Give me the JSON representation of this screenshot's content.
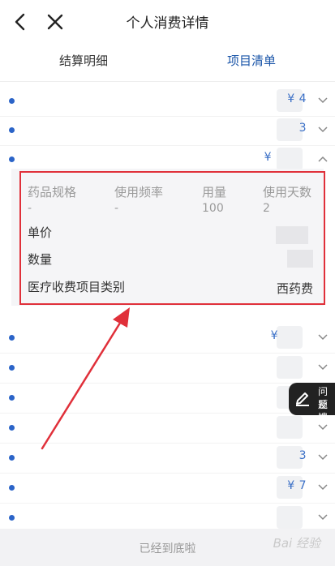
{
  "header": {
    "title": "个人消费详情"
  },
  "tabs": [
    {
      "label": "结算明细",
      "active": false
    },
    {
      "label": "项目清单",
      "active": true
    }
  ],
  "rows": [
    {
      "amount": "¥   4"
    },
    {
      "amount": "3"
    },
    {
      "amount": "¥"
    },
    {
      "amount": "¥"
    },
    {
      "amount": ""
    },
    {
      "amount": ""
    },
    {
      "amount": ""
    },
    {
      "amount": "3"
    },
    {
      "amount": "¥    7"
    },
    {
      "amount": ""
    }
  ],
  "detail": {
    "headers": [
      "药品规格",
      "使用频率",
      "用量",
      "使用天数"
    ],
    "values": [
      "-",
      "-",
      "100",
      "2"
    ],
    "unit_price_label": "单价",
    "quantity_label": "数量",
    "category_label": "医疗收费项目类别",
    "category_value": "西药费"
  },
  "feedback": {
    "line1": "问题",
    "line2": "反馈"
  },
  "footer": {
    "text": "已经到底啦",
    "watermark": "Bai 经验"
  },
  "colors": {
    "accent": "#1a55a8",
    "dot": "#2b64c8",
    "highlight": "#e0303a"
  }
}
